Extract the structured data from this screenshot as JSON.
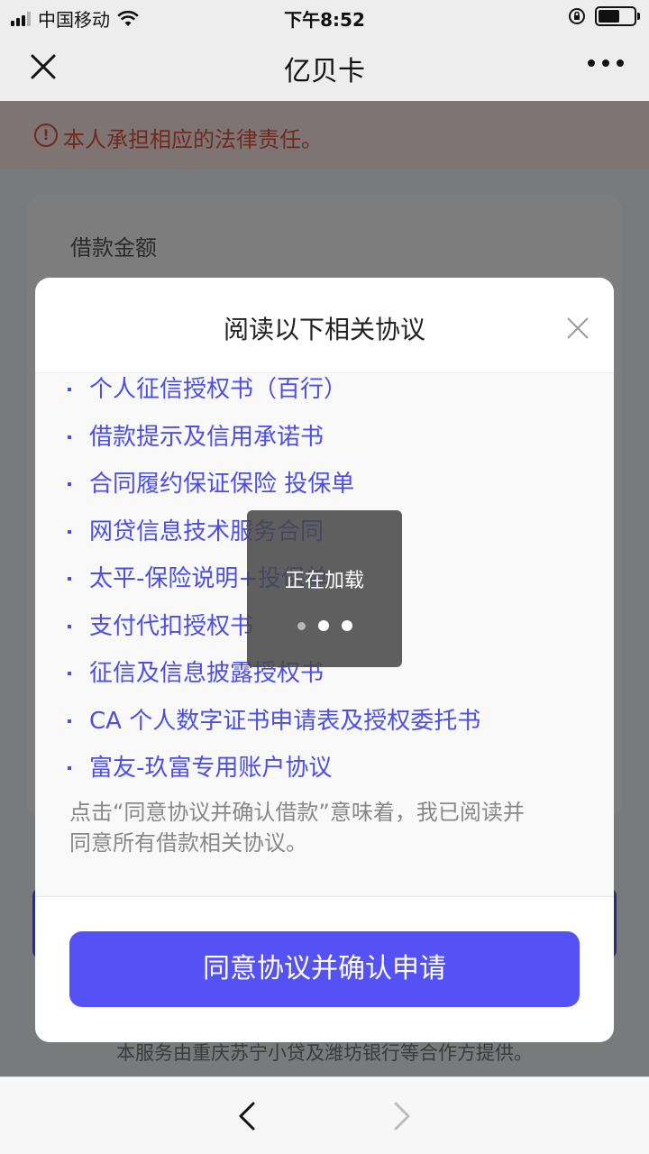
{
  "status_bar": {
    "carrier": "中国移动",
    "time": "下午8:52"
  },
  "nav": {
    "title": "亿贝卡"
  },
  "page": {
    "warning_text": "本人承担相应的法律责任。",
    "loan_label": "借款金额",
    "footer_note": "本服务由重庆苏宁小贷及潍坊银行等合作方提供。"
  },
  "modal": {
    "title": "阅读以下相关协议",
    "items": [
      "个人征信授权书（百行）",
      "借款提示及信用承诺书",
      "合同履约保证保险 投保单",
      "网贷信息技术服务合同",
      "太平-保险说明+投保单",
      "支付代扣授权书",
      "征信及信息披露授权书",
      "CA 个人数字证书申请表及授权委托书",
      "富友-玖富专用账户协议"
    ],
    "note": "点击“同意协议并确认借款”意味着，我已阅读并同意所有借款相关协议。",
    "confirm_label": "同意协议并确认申请"
  },
  "loading": {
    "text": "正在加载"
  },
  "colors": {
    "accent": "#5451f5",
    "link": "#4d4ee6",
    "warning": "#e2533e"
  }
}
